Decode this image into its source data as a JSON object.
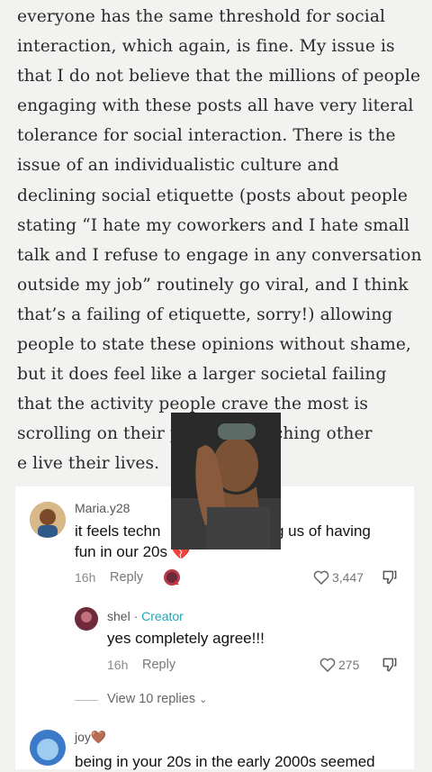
{
  "article": {
    "text": "everyone has the same threshold for social interaction, which again, is fine. My issue is that I do not believe that the millions of people engaging with these posts all have very literal tolerance for social interaction. There is the issue of an individualistic culture and declining social etiquette (posts about people stating “I hate my coworkers and I hate small talk and I refuse to engage in any conversation outside my job” routinely go viral, and I think that’s a failing of etiquette, sorry!) allowing people to state these opinions without shame, but it does feel like a larger societal failing that the activity people crave the most is scrolling on their phones, watching other",
    "text_after_overlay": "e live their lives."
  },
  "comments": [
    {
      "username": "Maria.y28",
      "text_line1_start": "it feels techn",
      "text_line1_end": "g us of having",
      "text_line2": "fun in our 20s",
      "emoji": "💔",
      "time": "16h",
      "reply_label": "Reply",
      "likes": "3,447"
    },
    {
      "username": "shel",
      "separator": " · ",
      "badge": "Creator",
      "text": "yes completely agree!!!",
      "time": "16h",
      "reply_label": "Reply",
      "likes": "275"
    }
  ],
  "view_replies": "View 10 replies",
  "next_comment": {
    "username": "joy",
    "emoji": "🤎",
    "text": "being in your 20s in the early 2000s seemed"
  },
  "colors": {
    "creator": "#1ea7b8",
    "heart": "#d22c3a"
  }
}
